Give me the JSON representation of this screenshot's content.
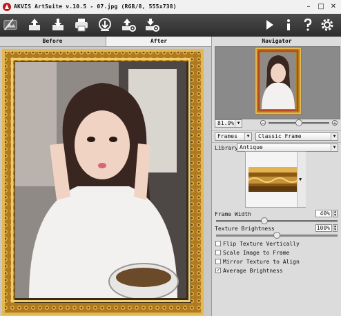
{
  "window": {
    "title": "AKVIS ArtSuite v.10.5 - 07.jpg (RGB/8, 555x738)",
    "controls": {
      "minimize": "–",
      "maximize": "□",
      "close": "✕"
    },
    "icon": "artsuite-app-icon"
  },
  "toolbar": {
    "left_icons": [
      "open-icon",
      "save-icon",
      "print-icon",
      "share-icon",
      "import-settings-icon",
      "export-settings-icon"
    ],
    "right_icons": [
      "run-icon",
      "info-icon",
      "help-icon",
      "preferences-gear-icon"
    ]
  },
  "view_tabs": [
    {
      "label": "Before",
      "active": false
    },
    {
      "label": "After",
      "active": true
    }
  ],
  "navigator": {
    "title": "Navigator",
    "zoom_value": "81.9%",
    "zoom_slider": 0.5
  },
  "effect": {
    "category": "Frames",
    "type": "Classic Frame"
  },
  "settings": {
    "library_label": "Library",
    "library_value": "Antique",
    "frame_width_label": "Frame Width",
    "frame_width_value": "40%",
    "frame_width_level": 0.4,
    "texture_brightness_label": "Texture Brightness",
    "texture_brightness_value": "100%",
    "texture_brightness_level": 0.5,
    "checkboxes": [
      {
        "label": "Flip Texture Vertically",
        "checked": false
      },
      {
        "label": "Scale Image to Frame",
        "checked": false
      },
      {
        "label": "Mirror Texture to Align",
        "checked": false
      },
      {
        "label": "Average Brightness",
        "checked": true
      }
    ]
  },
  "colors": {
    "toolbar_bg": "#3a3a3a",
    "frame_gold": "#c8912c",
    "panel_bg": "#dcdcdc"
  }
}
